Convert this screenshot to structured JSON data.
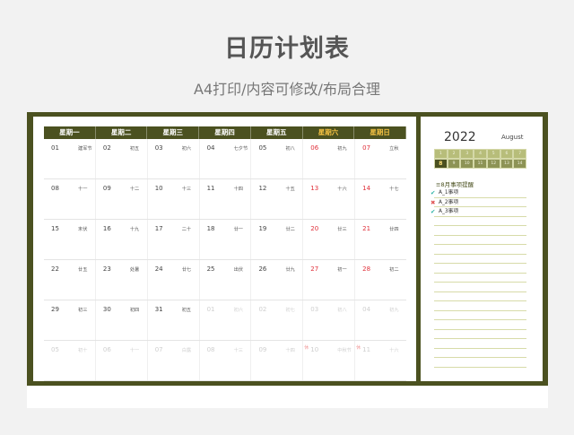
{
  "header": {
    "title": "日历计划表",
    "subtitle": "A4打印/内容可修改/布局合理"
  },
  "calendar": {
    "weekdays": [
      "星期一",
      "星期二",
      "星期三",
      "星期四",
      "星期五",
      "星期六",
      "星期日"
    ],
    "rows": [
      [
        {
          "d": "01",
          "l": "建军节"
        },
        {
          "d": "02",
          "l": "初五"
        },
        {
          "d": "03",
          "l": "初六"
        },
        {
          "d": "04",
          "l": "七夕节"
        },
        {
          "d": "05",
          "l": "初八"
        },
        {
          "d": "06",
          "l": "初九",
          "wk": true
        },
        {
          "d": "07",
          "l": "立秋",
          "wk": true
        }
      ],
      [
        {
          "d": "08",
          "l": "十一"
        },
        {
          "d": "09",
          "l": "十二"
        },
        {
          "d": "10",
          "l": "十三"
        },
        {
          "d": "11",
          "l": "十四"
        },
        {
          "d": "12",
          "l": "十五"
        },
        {
          "d": "13",
          "l": "十六",
          "wk": true
        },
        {
          "d": "14",
          "l": "十七",
          "wk": true
        }
      ],
      [
        {
          "d": "15",
          "l": "末伏"
        },
        {
          "d": "16",
          "l": "十九"
        },
        {
          "d": "17",
          "l": "二十"
        },
        {
          "d": "18",
          "l": "廿一"
        },
        {
          "d": "19",
          "l": "廿二"
        },
        {
          "d": "20",
          "l": "廿三",
          "wk": true
        },
        {
          "d": "21",
          "l": "廿四",
          "wk": true
        }
      ],
      [
        {
          "d": "22",
          "l": "廿五"
        },
        {
          "d": "23",
          "l": "处暑"
        },
        {
          "d": "24",
          "l": "廿七"
        },
        {
          "d": "25",
          "l": "出伏"
        },
        {
          "d": "26",
          "l": "廿九"
        },
        {
          "d": "27",
          "l": "初一",
          "wk": true
        },
        {
          "d": "28",
          "l": "初二",
          "wk": true
        }
      ],
      [
        {
          "d": "29",
          "l": "初三"
        },
        {
          "d": "30",
          "l": "初四"
        },
        {
          "d": "31",
          "l": "初五"
        },
        {
          "d": "01",
          "l": "初六",
          "dim": true
        },
        {
          "d": "02",
          "l": "初七",
          "dim": true
        },
        {
          "d": "03",
          "l": "初八",
          "dim": true
        },
        {
          "d": "04",
          "l": "初九",
          "dim": true
        }
      ],
      [
        {
          "d": "05",
          "l": "初十",
          "dim": true
        },
        {
          "d": "06",
          "l": "十一",
          "dim": true
        },
        {
          "d": "07",
          "l": "白露",
          "dim": true
        },
        {
          "d": "08",
          "l": "十三",
          "dim": true
        },
        {
          "d": "09",
          "l": "十四",
          "dim": true
        },
        {
          "d": "10",
          "l": "中秋节",
          "dim": true,
          "tag": "休"
        },
        {
          "d": "11",
          "l": "十六",
          "dim": true,
          "tag": "休"
        }
      ]
    ]
  },
  "side": {
    "year": "2022",
    "month": "August",
    "mini_rows": [
      [
        {
          "v": "1"
        },
        {
          "v": "2"
        },
        {
          "v": "3"
        },
        {
          "v": "4"
        },
        {
          "v": "5"
        },
        {
          "v": "6"
        },
        {
          "v": "7"
        }
      ],
      [
        {
          "v": "8",
          "on": true
        },
        {
          "v": "9"
        },
        {
          "v": "10"
        },
        {
          "v": "11"
        },
        {
          "v": "12"
        },
        {
          "v": "13"
        },
        {
          "v": "14"
        }
      ]
    ],
    "reminder_title": "≡8月事项提醒",
    "reminders": [
      {
        "mark": "✔",
        "type": "ok",
        "text": "A_1事项"
      },
      {
        "mark": "✖",
        "type": "no",
        "text": "A_2事项"
      },
      {
        "mark": "✔",
        "type": "ok",
        "text": "A_3事项"
      }
    ],
    "line_count": 19
  }
}
